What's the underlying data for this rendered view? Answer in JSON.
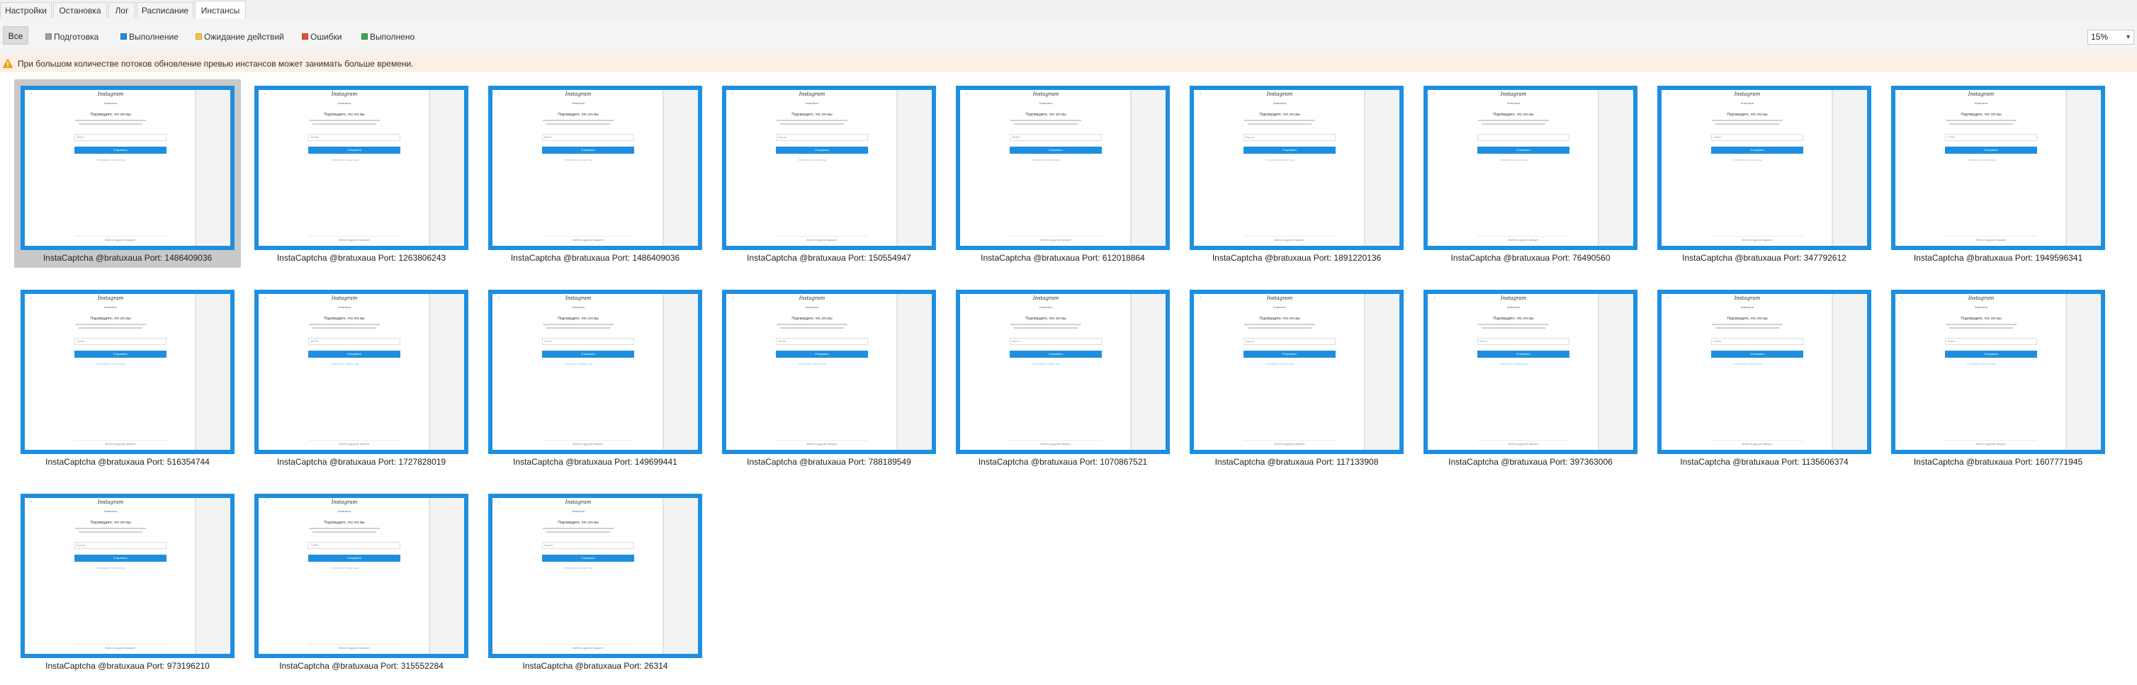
{
  "tabs": [
    {
      "label": "Настройки"
    },
    {
      "label": "Остановка"
    },
    {
      "label": "Лог"
    },
    {
      "label": "Расписание"
    },
    {
      "label": "Инстансы",
      "active": true
    }
  ],
  "filters": {
    "all_label": "Все",
    "items": [
      {
        "label": "Подготовка",
        "color": "#9e9e9e"
      },
      {
        "label": "Выполнение",
        "color": "#1e8fe0"
      },
      {
        "label": "Ожидание действий",
        "color": "#f5c242"
      },
      {
        "label": "Ошибки",
        "color": "#e0513c"
      },
      {
        "label": "Выполнено",
        "color": "#3ea64d"
      }
    ]
  },
  "zoom": {
    "value": "15%"
  },
  "warning": {
    "icon": "warning-triangle-icon",
    "text": "При большом количестве потоков обновление превью инстансов может занимать больше времени."
  },
  "preview": {
    "brand": "Instagram",
    "back": "‹",
    "username": "bratuxaua",
    "title": "Подтвердите, что это вы",
    "send_label": "Отправить",
    "resend_label": "Отправить новый код",
    "footer": "Войти в другой аккаунт"
  },
  "instances": [
    {
      "caption": "InstaCaptcha @bratuxaua Port: 1486409036",
      "code": "48547"
    },
    {
      "caption": "InstaCaptcha @bratuxaua Port: 1263806243",
      "code": "19548"
    },
    {
      "caption": "InstaCaptcha @bratuxaua Port: 1486409036",
      "code": "88217"
    },
    {
      "caption": "InstaCaptcha @bratuxaua Port: 150554947",
      "code": "Код из"
    },
    {
      "caption": "InstaCaptcha @bratuxaua Port: 612018864",
      "code": "28350"
    },
    {
      "caption": "InstaCaptcha @bratuxaua Port: 1891220136",
      "code": "Код из"
    },
    {
      "caption": "InstaCaptcha @bratuxaua Port: 76490560",
      "code": ""
    },
    {
      "caption": "InstaCaptcha @bratuxaua Port: 347792612",
      "code": "23567"
    },
    {
      "caption": "InstaCaptcha @bratuxaua Port: 1949596341",
      "code": "77581"
    },
    {
      "caption": "InstaCaptcha @bratuxaua Port: 516354744",
      "code": "18548"
    },
    {
      "caption": "InstaCaptcha @bratuxaua Port: 1727828019",
      "code": "98725"
    },
    {
      "caption": "InstaCaptcha @bratuxaua Port: 149699441",
      "code": "49349"
    },
    {
      "caption": "InstaCaptcha @bratuxaua Port: 788189549",
      "code": "58718"
    },
    {
      "caption": "InstaCaptcha @bratuxaua Port: 1070867521",
      "code": "48671"
    },
    {
      "caption": "InstaCaptcha @bratuxaua Port: 117133908",
      "code": "Код из"
    },
    {
      "caption": "InstaCaptcha @bratuxaua Port: 397363006",
      "code": "59520"
    },
    {
      "caption": "InstaCaptcha @bratuxaua Port: 1135606374",
      "code": "37584"
    },
    {
      "caption": "InstaCaptcha @bratuxaua Port: 1607771945",
      "code": "13839"
    },
    {
      "caption": "InstaCaptcha @bratuxaua Port: 973196210",
      "code": "Код из"
    },
    {
      "caption": "InstaCaptcha @bratuxaua Port: 315552284",
      "code": "77950"
    },
    {
      "caption": "InstaCaptcha @bratuxaua Port: 26314",
      "code": "Код из"
    }
  ]
}
